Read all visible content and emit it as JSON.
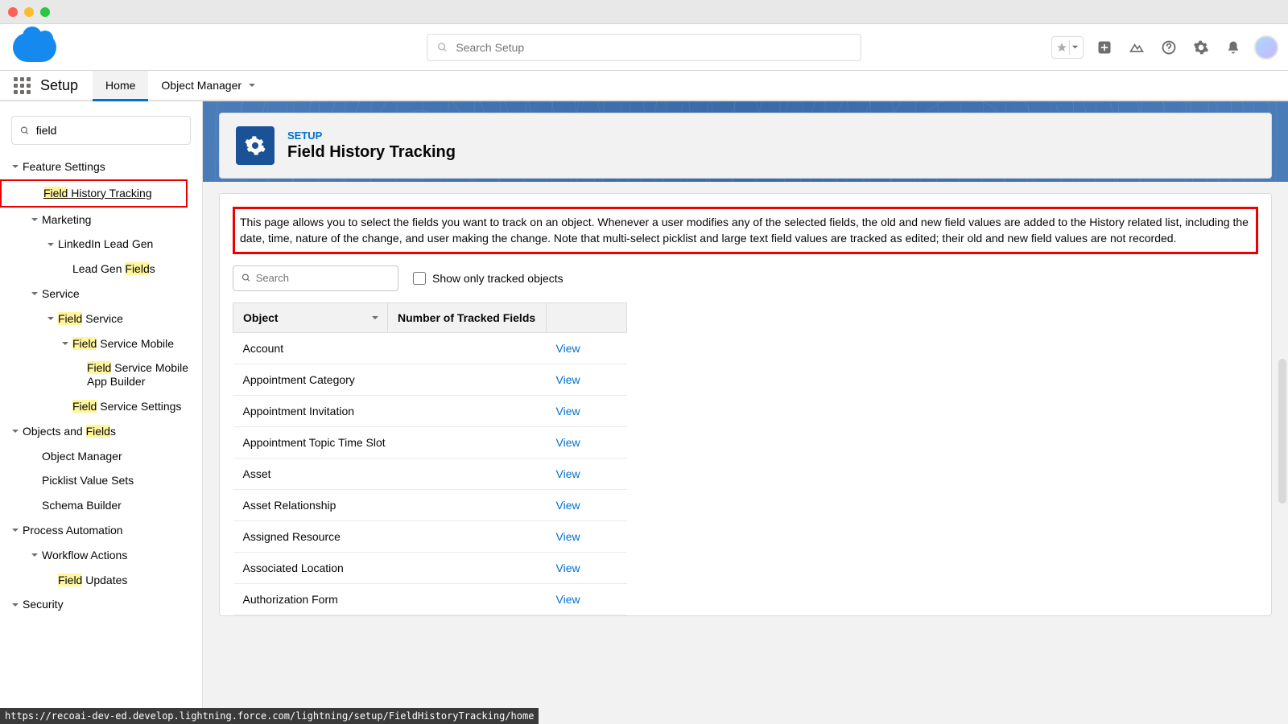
{
  "mac": {
    "dots": [
      "#ff5f57",
      "#febc2e",
      "#28c840"
    ]
  },
  "header": {
    "search_placeholder": "Search Setup"
  },
  "context": {
    "app_name": "Setup",
    "tabs": [
      "Home",
      "Object Manager"
    ]
  },
  "sidebar": {
    "quick_find_value": "field",
    "tree": [
      {
        "label": "Feature Settings",
        "depth": 0,
        "collapsed": false
      },
      {
        "label_html": "<span class='hl'>Field</span> History Tracking",
        "depth": 1,
        "leaf": true,
        "redbox": true
      },
      {
        "label": "Marketing",
        "depth": 1,
        "collapsed": false
      },
      {
        "label": "LinkedIn Lead Gen",
        "depth": 2,
        "collapsed": false
      },
      {
        "label_html": "Lead Gen <span class='hl'>Field</span>s",
        "depth": 3,
        "leaf": true
      },
      {
        "label": "Service",
        "depth": 1,
        "collapsed": false
      },
      {
        "label_html": "<span class='hl'>Field</span> Service",
        "depth": 2,
        "collapsed": false
      },
      {
        "label_html": "<span class='hl'>Field</span> Service Mobile",
        "depth": 3,
        "collapsed": false
      },
      {
        "label_html": "<span class='hl'>Field</span> Service Mobile App Builder",
        "depth": 4,
        "leaf": true
      },
      {
        "label_html": "<span class='hl'>Field</span> Service Settings",
        "depth": 3,
        "leaf": true
      },
      {
        "label_html": "Objects and <span class='hl'>Field</span>s",
        "depth": 0,
        "collapsed": false
      },
      {
        "label": "Object Manager",
        "depth": 1,
        "leaf": true
      },
      {
        "label": "Picklist Value Sets",
        "depth": 1,
        "leaf": true
      },
      {
        "label": "Schema Builder",
        "depth": 1,
        "leaf": true
      },
      {
        "label": "Process Automation",
        "depth": 0,
        "collapsed": false
      },
      {
        "label": "Workflow Actions",
        "depth": 1,
        "collapsed": false
      },
      {
        "label_html": "<span class='hl'>Field</span> Updates",
        "depth": 2,
        "leaf": true
      },
      {
        "label": "Security",
        "depth": 0,
        "collapsed": false
      }
    ]
  },
  "page": {
    "eyebrow": "SETUP",
    "title": "Field History Tracking",
    "description": "This page allows you to select the fields you want to track on an object. Whenever a user modifies any of the selected fields, the old and new field values are added to the History related list, including the date, time, nature of the change, and user making the change. Note that multi-select picklist and large text field values are tracked as edited; their old and new field values are not recorded.",
    "obj_search_placeholder": "Search",
    "show_tracked_label": "Show only tracked objects",
    "table": {
      "col_object": "Object",
      "col_tracked": "Number of Tracked Fields",
      "view": "View",
      "rows": [
        "Account",
        "Appointment Category",
        "Appointment Invitation",
        "Appointment Topic Time Slot",
        "Asset",
        "Asset Relationship",
        "Assigned Resource",
        "Associated Location",
        "Authorization Form"
      ]
    }
  },
  "status_url": "https://recoai-dev-ed.develop.lightning.force.com/lightning/setup/FieldHistoryTracking/home"
}
